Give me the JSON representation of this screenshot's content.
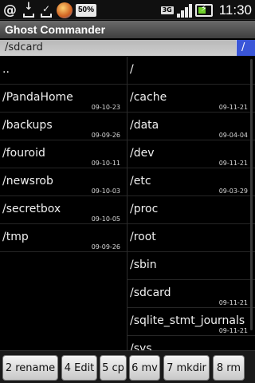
{
  "status_bar": {
    "icons": [
      "at-icon",
      "download-icon",
      "download-done-icon",
      "app-icon"
    ],
    "battery_label": "50%",
    "network": "3G",
    "time": "11:30"
  },
  "app": {
    "title": "Ghost Commander"
  },
  "path_bar": {
    "left": "/sdcard",
    "right": "/"
  },
  "left_panel": {
    "items": [
      {
        "name": "..",
        "date": ""
      },
      {
        "name": "/PandaHome",
        "date": "09-10-23"
      },
      {
        "name": "/backups",
        "date": "09-09-26"
      },
      {
        "name": "/fouroid",
        "date": "09-10-11"
      },
      {
        "name": "/newsrob",
        "date": "09-10-03"
      },
      {
        "name": "/secretbox",
        "date": "09-10-05"
      },
      {
        "name": "/tmp",
        "date": "09-09-26"
      }
    ]
  },
  "right_panel": {
    "items": [
      {
        "name": "/",
        "date": ""
      },
      {
        "name": "/cache",
        "date": "09-11-21"
      },
      {
        "name": "/data",
        "date": "09-04-04"
      },
      {
        "name": "/dev",
        "date": "09-11-21"
      },
      {
        "name": "/etc",
        "date": "09-03-29"
      },
      {
        "name": "/proc",
        "date": ""
      },
      {
        "name": "/root",
        "date": ""
      },
      {
        "name": "/sbin",
        "date": ""
      },
      {
        "name": "/sdcard",
        "date": "09-11-21"
      },
      {
        "name": "/sqlite_stmt_journals",
        "date": "09-11-21"
      },
      {
        "name": "/sys",
        "date": ""
      }
    ]
  },
  "toolbar": {
    "buttons": [
      "2 rename",
      "4 Edit",
      "5 cp",
      "6 mv",
      "7 mkdir",
      "8 rm"
    ]
  },
  "colors": {
    "accent": "#3a56d8",
    "title_bar": "#4a4a4a",
    "background": "#000000"
  }
}
